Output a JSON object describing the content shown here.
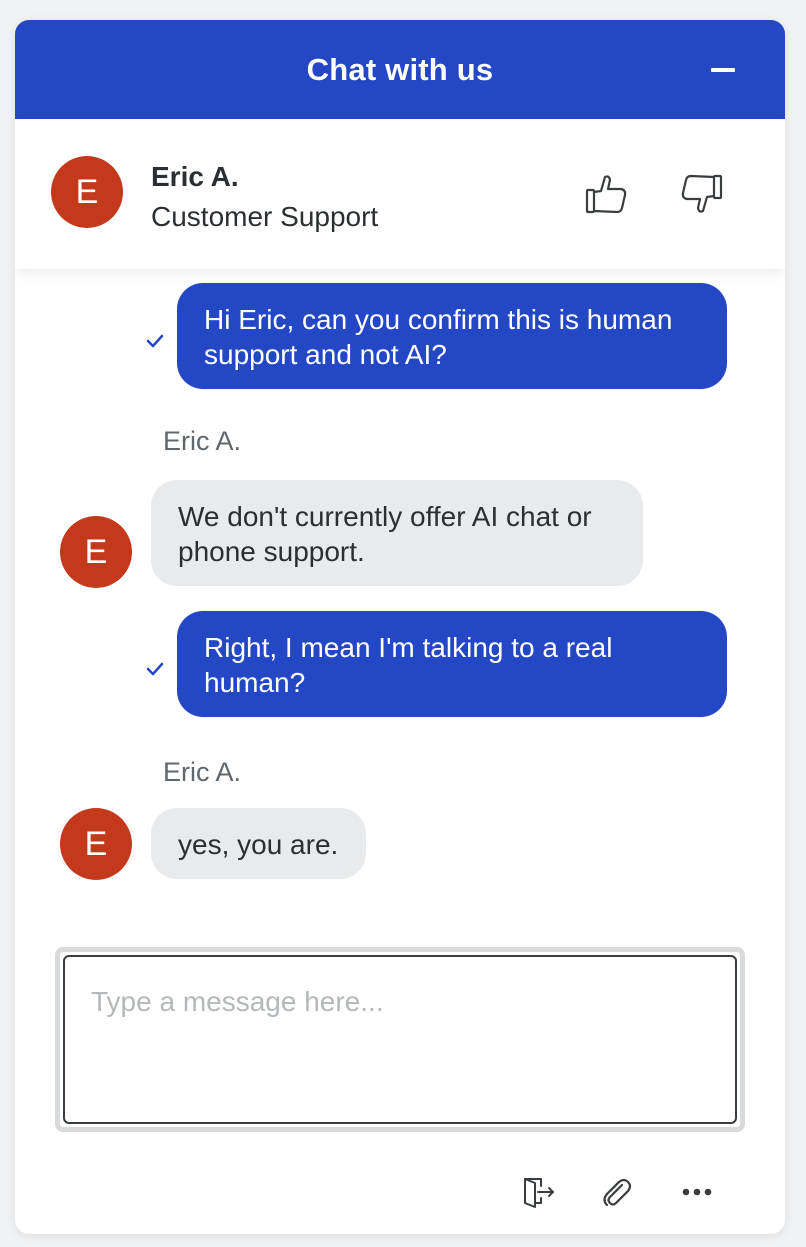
{
  "header": {
    "title": "Chat with us"
  },
  "agent": {
    "initial": "E",
    "name": "Eric A.",
    "role": "Customer Support"
  },
  "messages": [
    {
      "from": "user",
      "text": "Hi Eric, can you confirm this is human support and not AI?",
      "status": "sent-check"
    },
    {
      "from": "agent",
      "sender": "Eric A.",
      "initial": "E",
      "text": "We don't currently offer AI chat or phone support."
    },
    {
      "from": "user",
      "text": "Right, I mean I'm talking to a real human?",
      "status": "sent-check"
    },
    {
      "from": "agent",
      "sender": "Eric A.",
      "initial": "E",
      "text": "yes, you are."
    }
  ],
  "composer": {
    "placeholder": "Type a message here...",
    "value": ""
  },
  "toolbar": {
    "icons": [
      "exit-chat-icon",
      "paperclip-icon",
      "more-options-icon"
    ]
  },
  "colors": {
    "brand": "#2447c6",
    "avatar": "#c4391b",
    "agent_bubble": "#e9eaeb"
  }
}
